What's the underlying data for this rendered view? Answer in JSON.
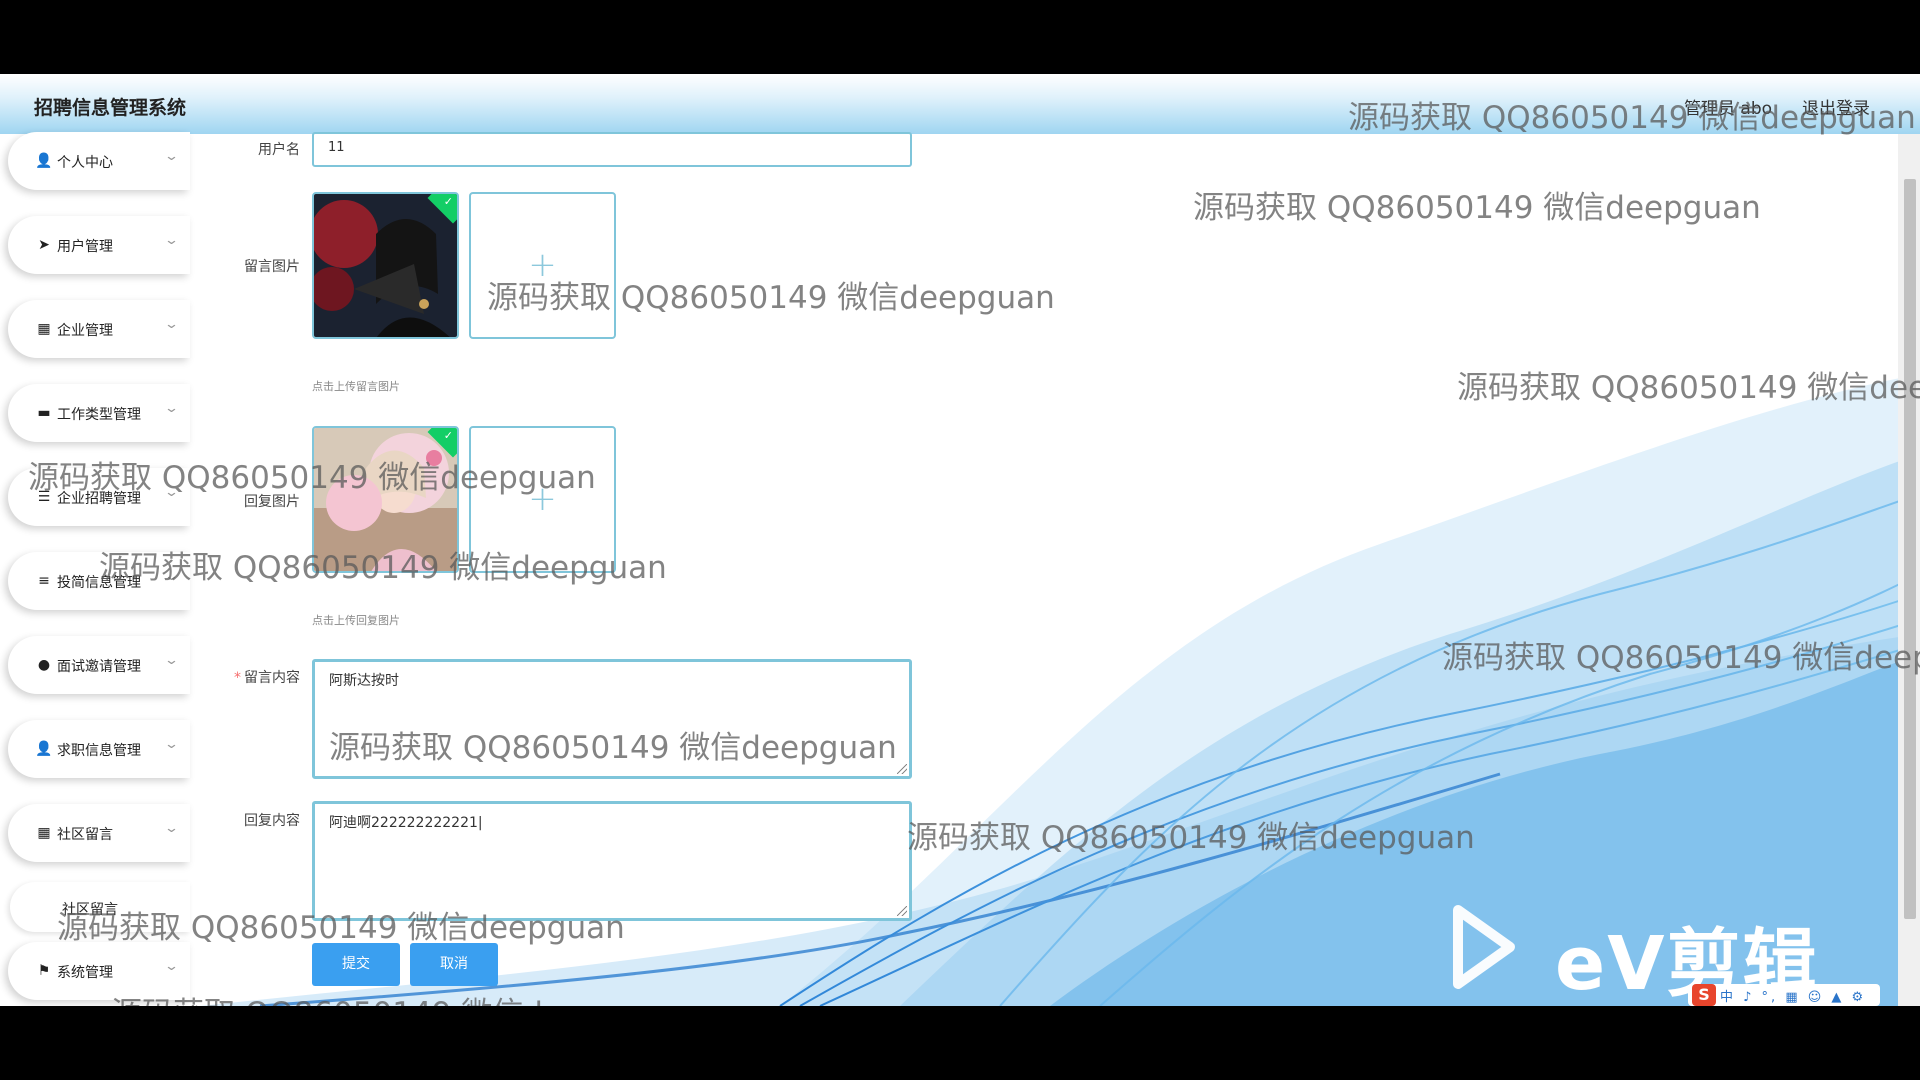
{
  "header": {
    "title": "招聘信息管理系统",
    "admin": "管理员 abo",
    "logout": "退出登录"
  },
  "sidebar": {
    "items": [
      {
        "label": "个人中心",
        "icon": "user-icon"
      },
      {
        "label": "用户管理",
        "icon": "send-icon"
      },
      {
        "label": "企业管理",
        "icon": "grid-icon"
      },
      {
        "label": "工作类型管理",
        "icon": "book-icon"
      },
      {
        "label": "企业招聘管理",
        "icon": "sliders-icon"
      },
      {
        "label": "投简信息管理",
        "icon": "list-icon"
      },
      {
        "label": "面试邀请管理",
        "icon": "bulb-icon"
      },
      {
        "label": "求职信息管理",
        "icon": "user-icon"
      },
      {
        "label": "社区留言",
        "icon": "grid-icon"
      },
      {
        "label": "系统管理",
        "icon": "flag-icon"
      }
    ],
    "submenu": {
      "label": "社区留言"
    }
  },
  "form": {
    "username": {
      "label": "用户名",
      "value": "11"
    },
    "message_image": {
      "label": "留言图片",
      "hint": "点击上传留言图片"
    },
    "reply_image": {
      "label": "回复图片",
      "hint": "点击上传回复图片"
    },
    "message_content": {
      "label": "留言内容",
      "required_mark": "*",
      "value": "阿斯达按时"
    },
    "reply_content": {
      "label": "回复内容",
      "value": "阿迪啊222222222221|"
    },
    "submit_label": "提交",
    "cancel_label": "取消"
  },
  "watermark": {
    "text": "源码获取 QQ86050149 微信deepguan",
    "text_cut": "源码获取 QQ86050149 微信deep",
    "text_cut2": "源码获取 QQ86050149 微信deepg"
  },
  "overlay": {
    "logo_text": "eV剪辑",
    "ime_text": "中 ♪ °, ▦ ☺ ▲ ⚙"
  },
  "colors": {
    "accent": "#3a9ff0",
    "border": "#7fc5da",
    "header_gradient_end": "#9fd5f1",
    "success": "#13ce66"
  }
}
